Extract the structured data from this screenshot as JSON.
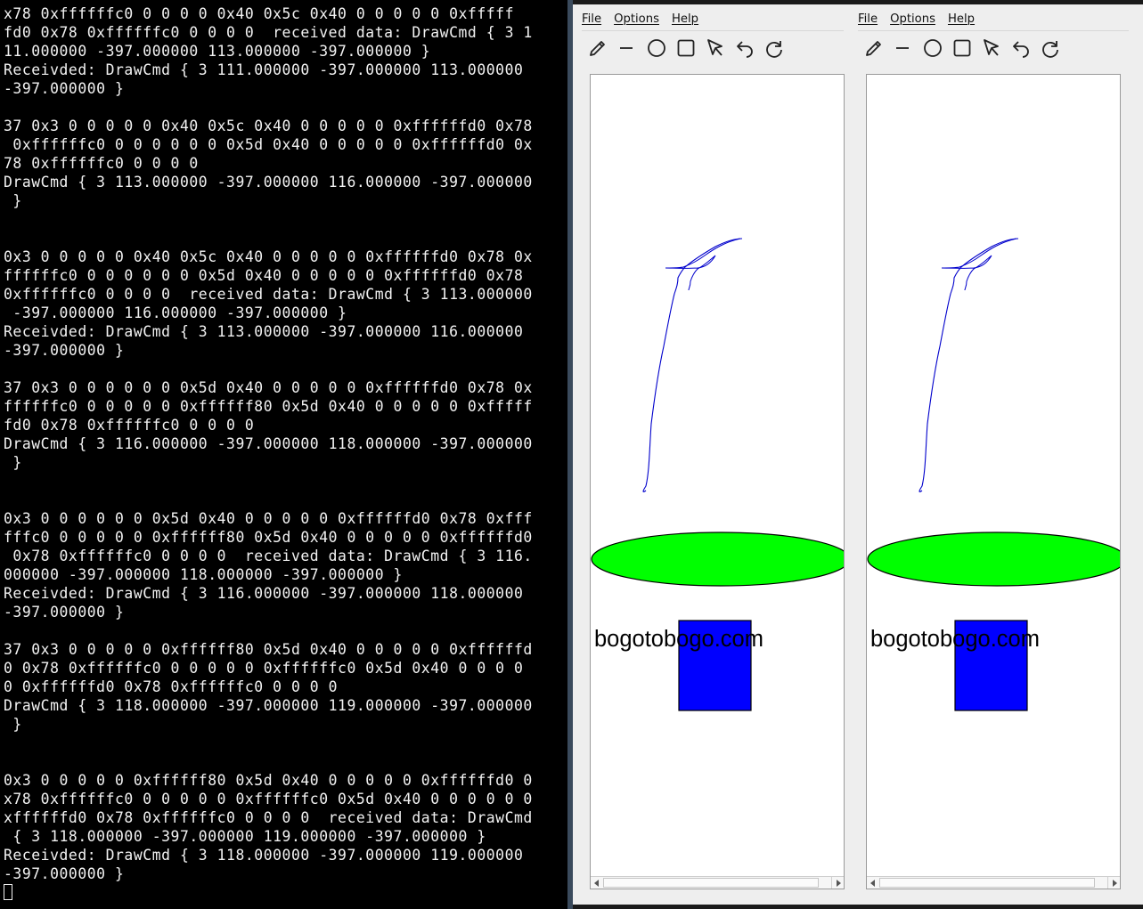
{
  "terminal": {
    "lines": [
      "x78 0xffffffc0 0 0 0 0 0x40 0x5c 0x40 0 0 0 0 0 0xfffff",
      "fd0 0x78 0xffffffc0 0 0 0 0  received data: DrawCmd { 3 1",
      "11.000000 -397.000000 113.000000 -397.000000 }",
      "Receivded: DrawCmd { 3 111.000000 -397.000000 113.000000",
      "-397.000000 }",
      "",
      "37 0x3 0 0 0 0 0 0x40 0x5c 0x40 0 0 0 0 0 0xffffffd0 0x78",
      " 0xffffffc0 0 0 0 0 0 0 0x5d 0x40 0 0 0 0 0 0xffffffd0 0x",
      "78 0xffffffc0 0 0 0 0",
      "DrawCmd { 3 113.000000 -397.000000 116.000000 -397.000000",
      " }",
      "",
      "",
      "0x3 0 0 0 0 0 0x40 0x5c 0x40 0 0 0 0 0 0xffffffd0 0x78 0x",
      "ffffffc0 0 0 0 0 0 0 0x5d 0x40 0 0 0 0 0 0xffffffd0 0x78",
      "0xffffffc0 0 0 0 0  received data: DrawCmd { 3 113.000000",
      " -397.000000 116.000000 -397.000000 }",
      "Receivded: DrawCmd { 3 113.000000 -397.000000 116.000000",
      "-397.000000 }",
      "",
      "37 0x3 0 0 0 0 0 0 0x5d 0x40 0 0 0 0 0 0xffffffd0 0x78 0x",
      "ffffffc0 0 0 0 0 0 0xffffff80 0x5d 0x40 0 0 0 0 0 0xfffff",
      "fd0 0x78 0xffffffc0 0 0 0 0",
      "DrawCmd { 3 116.000000 -397.000000 118.000000 -397.000000",
      " }",
      "",
      "",
      "0x3 0 0 0 0 0 0 0x5d 0x40 0 0 0 0 0 0xffffffd0 0x78 0xfff",
      "fffc0 0 0 0 0 0 0xffffff80 0x5d 0x40 0 0 0 0 0 0xffffffd0",
      " 0x78 0xffffffc0 0 0 0 0  received data: DrawCmd { 3 116.",
      "000000 -397.000000 118.000000 -397.000000 }",
      "Receivded: DrawCmd { 3 116.000000 -397.000000 118.000000",
      "-397.000000 }",
      "",
      "37 0x3 0 0 0 0 0 0xffffff80 0x5d 0x40 0 0 0 0 0 0xffffffd",
      "0 0x78 0xffffffc0 0 0 0 0 0 0xffffffc0 0x5d 0x40 0 0 0 0",
      "0 0xffffffd0 0x78 0xffffffc0 0 0 0 0",
      "DrawCmd { 3 118.000000 -397.000000 119.000000 -397.000000",
      " }",
      "",
      "",
      "0x3 0 0 0 0 0 0xffffff80 0x5d 0x40 0 0 0 0 0 0xffffffd0 0",
      "x78 0xffffffc0 0 0 0 0 0 0xffffffc0 0x5d 0x40 0 0 0 0 0 0",
      "xffffffd0 0x78 0xffffffc0 0 0 0 0  received data: DrawCmd",
      " { 3 118.000000 -397.000000 119.000000 -397.000000 }",
      "Receivded: DrawCmd { 3 118.000000 -397.000000 119.000000",
      "-397.000000 }"
    ]
  },
  "app": {
    "menu": [
      "File",
      "Options",
      "Help"
    ],
    "tools": [
      {
        "name": "pencil-tool",
        "icon": "pencil-icon"
      },
      {
        "name": "line-tool",
        "icon": "line-icon"
      },
      {
        "name": "ellipse-tool",
        "icon": "circle-icon"
      },
      {
        "name": "rectangle-tool",
        "icon": "square-icon"
      },
      {
        "name": "select-tool",
        "icon": "cursor-arrow-icon"
      },
      {
        "name": "undo-button",
        "icon": "undo-icon"
      },
      {
        "name": "redo-button",
        "icon": "redo-icon"
      }
    ],
    "canvas": {
      "text": "bogotobogo.com",
      "stroke_color": "#0000cc",
      "ellipse_fill": "#00ff00",
      "rect_fill": "#0000ff"
    }
  }
}
